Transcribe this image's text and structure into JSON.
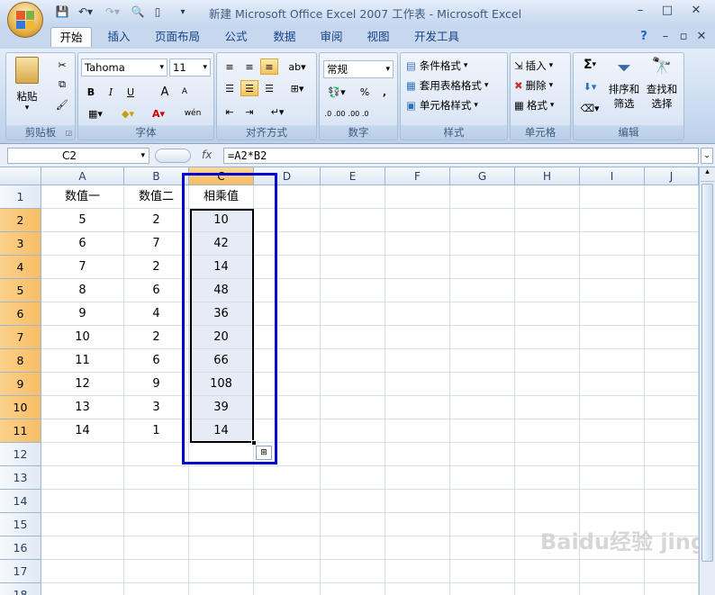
{
  "title": "新建 Microsoft Office Excel 2007 工作表 - Microsoft Excel",
  "window_controls": [
    "–",
    "□",
    "✕"
  ],
  "ribbon_controls": [
    "?",
    "–",
    "▫",
    "✕"
  ],
  "tabs": [
    "开始",
    "插入",
    "页面布局",
    "公式",
    "数据",
    "审阅",
    "视图",
    "开发工具"
  ],
  "active_tab": "开始",
  "groups": {
    "clipboard": {
      "label": "剪贴板",
      "paste": "粘贴"
    },
    "font": {
      "label": "字体",
      "font_name": "Tahoma",
      "font_size": "11",
      "bold": "B",
      "italic": "I",
      "underline": "U",
      "grow": "A",
      "shrink": "A",
      "phonetic": "wén"
    },
    "alignment": {
      "label": "对齐方式"
    },
    "number": {
      "label": "数字",
      "format": "常规",
      "percent": "%",
      "comma": ",",
      "inc_decimal": ".0 .00",
      "dec_decimal": ".00 .0"
    },
    "styles": {
      "label": "样式",
      "conditional": "条件格式",
      "table": "套用表格格式",
      "cell_styles": "单元格样式"
    },
    "cells": {
      "label": "单元格",
      "insert": "插入",
      "delete": "删除",
      "format": "格式"
    },
    "editing": {
      "label": "编辑",
      "sigma": "Σ",
      "sort_filter": [
        "排序和",
        "筛选"
      ],
      "find_select": [
        "查找和",
        "选择"
      ]
    }
  },
  "namebox": "C2",
  "fx": "fx",
  "formula": "=A2*B2",
  "columns": [
    "A",
    "B",
    "C",
    "D",
    "E",
    "F",
    "G",
    "H",
    "I",
    "J"
  ],
  "selected_column": "C",
  "rows": [
    [
      "数值一",
      "数值二",
      "相乘值"
    ],
    [
      "5",
      "2",
      "10"
    ],
    [
      "6",
      "7",
      "42"
    ],
    [
      "7",
      "2",
      "14"
    ],
    [
      "8",
      "6",
      "48"
    ],
    [
      "9",
      "4",
      "36"
    ],
    [
      "10",
      "2",
      "20"
    ],
    [
      "11",
      "6",
      "66"
    ],
    [
      "12",
      "9",
      "108"
    ],
    [
      "13",
      "3",
      "39"
    ],
    [
      "14",
      "1",
      "14"
    ]
  ],
  "row_numbers": [
    "1",
    "2",
    "3",
    "4",
    "5",
    "6",
    "7",
    "8",
    "9",
    "10",
    "11",
    "12",
    "13",
    "14",
    "15",
    "16",
    "17",
    "18"
  ],
  "watermark": "Baidu经验 jingyan.baidu.com",
  "colors": {
    "selection_border": "#0000d0",
    "selected_header": "#f7bb5f",
    "selected_cells": "#e6ebf5"
  }
}
